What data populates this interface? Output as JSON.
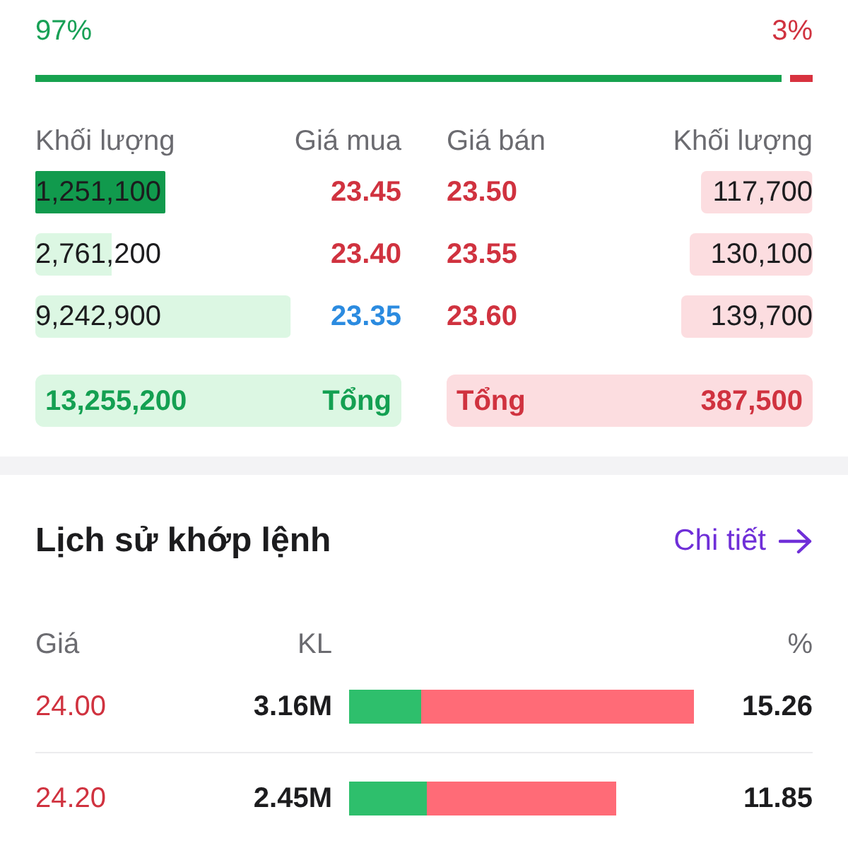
{
  "ratio": {
    "buy_label": "97%",
    "sell_label": "3%",
    "level": 0.96
  },
  "order_book": {
    "headers": [
      "Khối lượng",
      "Giá mua",
      "Giá bán",
      "Khối lượng"
    ],
    "bids": [
      {
        "volume": "1,251,100",
        "price": "23.45",
        "color": "#d0323f",
        "highlighted": true
      },
      {
        "volume": "2,761,200",
        "price": "23.40",
        "color": "#d0323f",
        "highlighted": false
      },
      {
        "volume": "9,242,900",
        "price": "23.35",
        "color": "#2b8be0",
        "highlighted": false
      }
    ],
    "asks": [
      {
        "price": "23.50",
        "color": "#d0323f",
        "volume": "117,700",
        "highlighted": false
      },
      {
        "price": "23.55",
        "color": "#d0323f",
        "volume": "130,100",
        "highlighted": false
      },
      {
        "price": "23.60",
        "color": "#d0323f",
        "volume": "139,700",
        "highlighted": false
      }
    ],
    "bid_total": {
      "volume": "13,255,200",
      "label": "Tổng"
    },
    "ask_total": {
      "label": "Tổng",
      "volume": "387,500"
    }
  },
  "match_history": {
    "title": "Lịch sử khớp lệnh",
    "details_link": "Chi tiết",
    "columns": [
      "Giá",
      "KL",
      "%"
    ],
    "rows": [
      {
        "price": "24.00",
        "volume": "3.16M",
        "buy_share": {
          "level": 0.21
        },
        "percent": "15.26"
      },
      {
        "price": "24.20",
        "volume": "2.45M",
        "buy_share": {
          "level": 0.29
        },
        "percent": "11.85"
      }
    ]
  }
}
